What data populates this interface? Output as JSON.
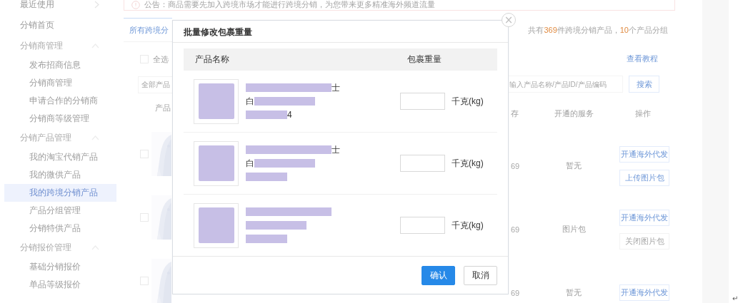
{
  "sidebar": {
    "items": [
      {
        "label": "最近使用",
        "kind": "link",
        "selected": false
      },
      {
        "label": "分销首页",
        "kind": "link",
        "selected": false
      },
      {
        "label": "分销商管理",
        "kind": "group",
        "expanded": true,
        "children": [
          {
            "label": "发布招商信息",
            "selected": false
          },
          {
            "label": "分销商管理",
            "selected": false
          },
          {
            "label": "申请合作的分销商",
            "selected": false
          },
          {
            "label": "分销商等级管理",
            "selected": false
          }
        ]
      },
      {
        "label": "分销产品管理",
        "kind": "group",
        "expanded": true,
        "children": [
          {
            "label": "我的淘宝代销产品",
            "selected": false
          },
          {
            "label": "我的微供产品",
            "selected": false
          },
          {
            "label": "我的跨境分销产品",
            "selected": true
          },
          {
            "label": "产品分组管理",
            "selected": false
          },
          {
            "label": "分销特供产品",
            "selected": false
          }
        ]
      },
      {
        "label": "分销报价管理",
        "kind": "group",
        "expanded": true,
        "children": [
          {
            "label": "基础分销报价",
            "selected": false
          },
          {
            "label": "单品等级报价",
            "selected": false
          }
        ]
      }
    ]
  },
  "notice": "公告：商品需要先加入跨境市场才能进行跨境分销，为您带来更多精准海外频道流量",
  "tab": {
    "label": "所有跨境分",
    "selected": true
  },
  "summary": {
    "prefix": "共有",
    "count": "369",
    "middle": "件跨境分销产品，",
    "groups": "10",
    "suffix": "个产品分组"
  },
  "select_all": {
    "label": "全选",
    "checked": false
  },
  "tutorial_link": "查看教程",
  "filter": {
    "value": "全部产品"
  },
  "search": {
    "placeholder": "输入产品名称/产品ID/产品编码",
    "button": "搜索"
  },
  "table": {
    "columns": [
      "产品",
      "存",
      "开通的服务",
      "操作"
    ],
    "rows": [
      {
        "checked": false,
        "stock": "69",
        "service": "暂无",
        "actions": [
          "开通海外代发",
          "上传图片包"
        ]
      },
      {
        "checked": false,
        "stock": "69",
        "service": "图片包",
        "actions": [
          "开通海外代发",
          "关闭图片包"
        ]
      },
      {
        "checked": false,
        "stock": "69",
        "service": "暂无",
        "actions": [
          "开通海外代发"
        ]
      }
    ]
  },
  "corner_mark": "↵",
  "dialog": {
    "title": "批量修改包裹重量",
    "close": "×",
    "columns": [
      "产品名称",
      "包裹重量"
    ],
    "rows": [
      {
        "lines": [
          {
            "redacted": true,
            "suffix": "士"
          },
          {
            "redacted": true,
            "prefix": "白"
          },
          {
            "redacted": true,
            "suffix": "4"
          }
        ],
        "unit": "千克(kg)"
      },
      {
        "lines": [
          {
            "redacted": true,
            "suffix": "士"
          },
          {
            "redacted": true,
            "prefix": "白"
          },
          {
            "redacted": true
          }
        ],
        "unit": "千克(kg)"
      },
      {
        "lines": [
          {
            "redacted": true
          },
          {
            "redacted": true
          },
          {
            "redacted": true
          }
        ],
        "unit": "千克(kg)"
      }
    ],
    "buttons": [
      {
        "label": "确认",
        "kind": "primary"
      },
      {
        "label": "取消",
        "kind": "default"
      }
    ]
  }
}
